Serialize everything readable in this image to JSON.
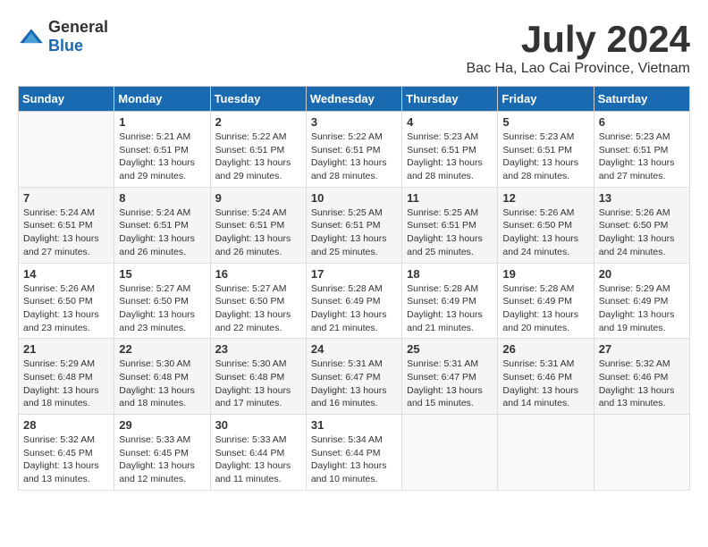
{
  "header": {
    "logo_general": "General",
    "logo_blue": "Blue",
    "title": "July 2024",
    "subtitle": "Bac Ha, Lao Cai Province, Vietnam"
  },
  "calendar": {
    "days_of_week": [
      "Sunday",
      "Monday",
      "Tuesday",
      "Wednesday",
      "Thursday",
      "Friday",
      "Saturday"
    ],
    "weeks": [
      [
        {
          "day": "",
          "info": ""
        },
        {
          "day": "1",
          "info": "Sunrise: 5:21 AM\nSunset: 6:51 PM\nDaylight: 13 hours\nand 29 minutes."
        },
        {
          "day": "2",
          "info": "Sunrise: 5:22 AM\nSunset: 6:51 PM\nDaylight: 13 hours\nand 29 minutes."
        },
        {
          "day": "3",
          "info": "Sunrise: 5:22 AM\nSunset: 6:51 PM\nDaylight: 13 hours\nand 28 minutes."
        },
        {
          "day": "4",
          "info": "Sunrise: 5:23 AM\nSunset: 6:51 PM\nDaylight: 13 hours\nand 28 minutes."
        },
        {
          "day": "5",
          "info": "Sunrise: 5:23 AM\nSunset: 6:51 PM\nDaylight: 13 hours\nand 28 minutes."
        },
        {
          "day": "6",
          "info": "Sunrise: 5:23 AM\nSunset: 6:51 PM\nDaylight: 13 hours\nand 27 minutes."
        }
      ],
      [
        {
          "day": "7",
          "info": "Sunrise: 5:24 AM\nSunset: 6:51 PM\nDaylight: 13 hours\nand 27 minutes."
        },
        {
          "day": "8",
          "info": "Sunrise: 5:24 AM\nSunset: 6:51 PM\nDaylight: 13 hours\nand 26 minutes."
        },
        {
          "day": "9",
          "info": "Sunrise: 5:24 AM\nSunset: 6:51 PM\nDaylight: 13 hours\nand 26 minutes."
        },
        {
          "day": "10",
          "info": "Sunrise: 5:25 AM\nSunset: 6:51 PM\nDaylight: 13 hours\nand 25 minutes."
        },
        {
          "day": "11",
          "info": "Sunrise: 5:25 AM\nSunset: 6:51 PM\nDaylight: 13 hours\nand 25 minutes."
        },
        {
          "day": "12",
          "info": "Sunrise: 5:26 AM\nSunset: 6:50 PM\nDaylight: 13 hours\nand 24 minutes."
        },
        {
          "day": "13",
          "info": "Sunrise: 5:26 AM\nSunset: 6:50 PM\nDaylight: 13 hours\nand 24 minutes."
        }
      ],
      [
        {
          "day": "14",
          "info": "Sunrise: 5:26 AM\nSunset: 6:50 PM\nDaylight: 13 hours\nand 23 minutes."
        },
        {
          "day": "15",
          "info": "Sunrise: 5:27 AM\nSunset: 6:50 PM\nDaylight: 13 hours\nand 23 minutes."
        },
        {
          "day": "16",
          "info": "Sunrise: 5:27 AM\nSunset: 6:50 PM\nDaylight: 13 hours\nand 22 minutes."
        },
        {
          "day": "17",
          "info": "Sunrise: 5:28 AM\nSunset: 6:49 PM\nDaylight: 13 hours\nand 21 minutes."
        },
        {
          "day": "18",
          "info": "Sunrise: 5:28 AM\nSunset: 6:49 PM\nDaylight: 13 hours\nand 21 minutes."
        },
        {
          "day": "19",
          "info": "Sunrise: 5:28 AM\nSunset: 6:49 PM\nDaylight: 13 hours\nand 20 minutes."
        },
        {
          "day": "20",
          "info": "Sunrise: 5:29 AM\nSunset: 6:49 PM\nDaylight: 13 hours\nand 19 minutes."
        }
      ],
      [
        {
          "day": "21",
          "info": "Sunrise: 5:29 AM\nSunset: 6:48 PM\nDaylight: 13 hours\nand 18 minutes."
        },
        {
          "day": "22",
          "info": "Sunrise: 5:30 AM\nSunset: 6:48 PM\nDaylight: 13 hours\nand 18 minutes."
        },
        {
          "day": "23",
          "info": "Sunrise: 5:30 AM\nSunset: 6:48 PM\nDaylight: 13 hours\nand 17 minutes."
        },
        {
          "day": "24",
          "info": "Sunrise: 5:31 AM\nSunset: 6:47 PM\nDaylight: 13 hours\nand 16 minutes."
        },
        {
          "day": "25",
          "info": "Sunrise: 5:31 AM\nSunset: 6:47 PM\nDaylight: 13 hours\nand 15 minutes."
        },
        {
          "day": "26",
          "info": "Sunrise: 5:31 AM\nSunset: 6:46 PM\nDaylight: 13 hours\nand 14 minutes."
        },
        {
          "day": "27",
          "info": "Sunrise: 5:32 AM\nSunset: 6:46 PM\nDaylight: 13 hours\nand 13 minutes."
        }
      ],
      [
        {
          "day": "28",
          "info": "Sunrise: 5:32 AM\nSunset: 6:45 PM\nDaylight: 13 hours\nand 13 minutes."
        },
        {
          "day": "29",
          "info": "Sunrise: 5:33 AM\nSunset: 6:45 PM\nDaylight: 13 hours\nand 12 minutes."
        },
        {
          "day": "30",
          "info": "Sunrise: 5:33 AM\nSunset: 6:44 PM\nDaylight: 13 hours\nand 11 minutes."
        },
        {
          "day": "31",
          "info": "Sunrise: 5:34 AM\nSunset: 6:44 PM\nDaylight: 13 hours\nand 10 minutes."
        },
        {
          "day": "",
          "info": ""
        },
        {
          "day": "",
          "info": ""
        },
        {
          "day": "",
          "info": ""
        }
      ]
    ]
  }
}
